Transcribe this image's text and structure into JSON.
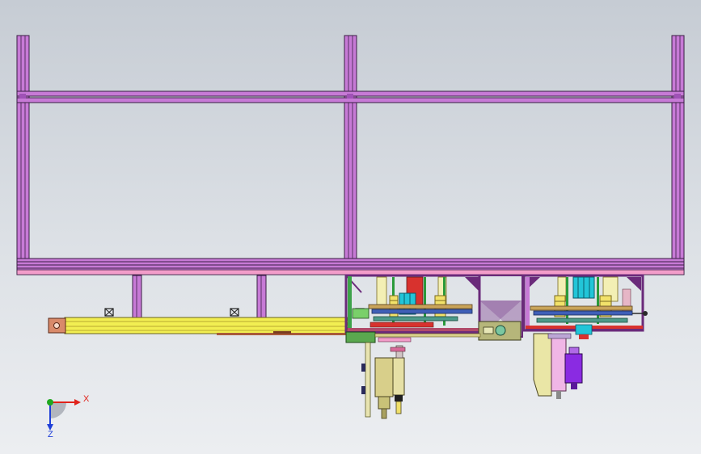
{
  "viewport": {
    "background_top": "#c6ccd4",
    "background_bottom": "#eceef1"
  },
  "colors": {
    "frame_profile": "#c77ad6",
    "frame_outline": "#3a1f44",
    "rail_yellow": "#f2ee52",
    "end_block": "#d98a6a",
    "plate_blue": "#3f5fb8",
    "block_green": "#5aa84f",
    "cylinder_tan": "#d8cf8a",
    "motor_purple": "#8a2be2",
    "accent_cyan": "#22c5d8",
    "accent_red": "#d8322e",
    "axis_x": "#e0231b",
    "axis_y": "#1fa81f",
    "axis_z": "#1f3fd8"
  },
  "triad": {
    "x_label": "X",
    "z_label": "Z"
  }
}
